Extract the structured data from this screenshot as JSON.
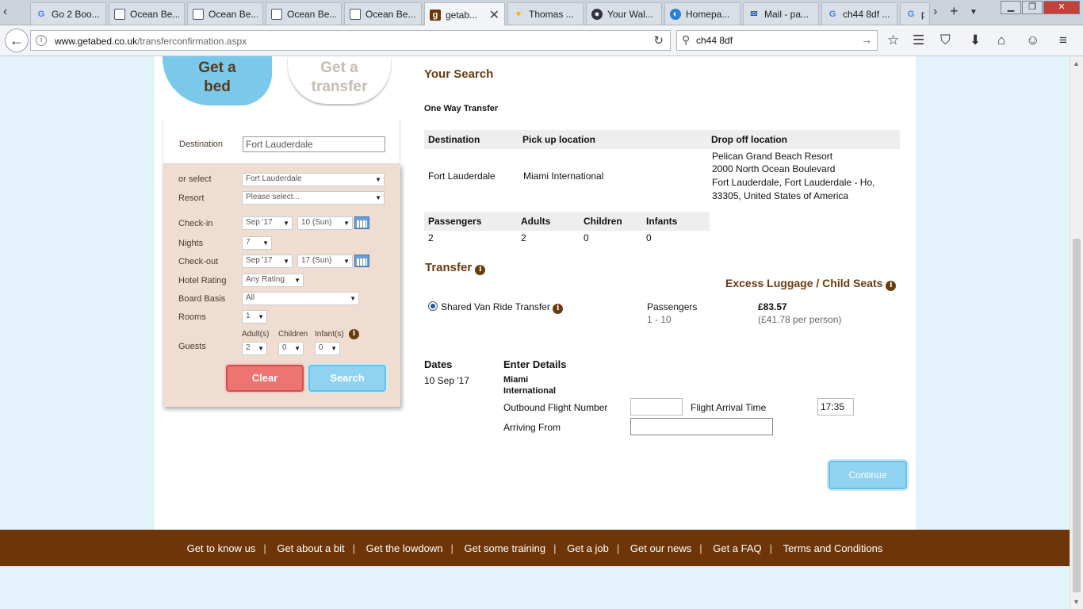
{
  "browser": {
    "tabs": [
      {
        "label": "Go 2 Boo...",
        "icon": "google-icon"
      },
      {
        "label": "Ocean Be...",
        "icon": "doc-icon"
      },
      {
        "label": "Ocean Be...",
        "icon": "doc-icon"
      },
      {
        "label": "Ocean Be...",
        "icon": "doc-icon"
      },
      {
        "label": "Ocean Be...",
        "icon": "doc-icon"
      },
      {
        "label": "getab...",
        "icon": "getabed-icon"
      },
      {
        "label": "Thomas ...",
        "icon": "heart-icon"
      },
      {
        "label": "Your Wal...",
        "icon": "shield-icon"
      },
      {
        "label": "Homepa...",
        "icon": "globe-icon"
      },
      {
        "label": "Mail - pa...",
        "icon": "mail-icon"
      },
      {
        "label": "ch44 8df ...",
        "icon": "google-icon"
      },
      {
        "label": "p",
        "icon": "google-icon"
      }
    ],
    "url_domain": "www.getabed.co.uk",
    "url_path": "/transferconfirmation.aspx",
    "search_value": "ch44 8df"
  },
  "left_panel": {
    "tab_getabed_line1": "Get a",
    "tab_getabed_line2": "bed",
    "tab_transfer_line1": "Get a",
    "tab_transfer_line2": "transfer",
    "destination_label": "Destination",
    "destination_value": "Fort Lauderdale",
    "or_select_label": "or select",
    "or_select_value": "Fort Lauderdale",
    "resort_label": "Resort",
    "resort_value": "Please select...",
    "checkin_label": "Check-in",
    "checkin_month": "Sep '17",
    "checkin_day": "10 (Sun)",
    "nights_label": "Nights",
    "nights_value": "7",
    "checkout_label": "Check-out",
    "checkout_month": "Sep '17",
    "checkout_day": "17 (Sun)",
    "hotel_rating_label": "Hotel Rating",
    "hotel_rating_value": "Any Rating",
    "board_basis_label": "Board Basis",
    "board_basis_value": "All",
    "rooms_label": "Rooms",
    "rooms_value": "1",
    "guests_label": "Guests",
    "adults_label": "Adult(s)",
    "children_label": "Children",
    "infants_label": "Infant(s)",
    "adults_value": "2",
    "children_value": "0",
    "infants_value": "0",
    "clear_label": "Clear",
    "search_label": "Search"
  },
  "search_summary": {
    "title": "Your Search",
    "type": "One Way Transfer",
    "col_destination": "Destination",
    "col_pickup": "Pick up location",
    "col_dropoff": "Drop off location",
    "destination": "Fort Lauderdale",
    "pickup": "Miami International",
    "dropoff_line1": "Pelican Grand Beach Resort",
    "dropoff_line2": "2000 North Ocean Boulevard",
    "dropoff_line3": "Fort Lauderdale, Fort Lauderdale - Ho,",
    "dropoff_line4": "33305, United States of America",
    "col_passengers": "Passengers",
    "col_adults": "Adults",
    "col_children": "Children",
    "col_infants": "Infants",
    "passengers": "2",
    "adults": "2",
    "children": "0",
    "infants": "0"
  },
  "transfer": {
    "title": "Transfer",
    "excess_title": "Excess Luggage / Child Seats",
    "option_label": "Shared Van Ride Transfer",
    "passengers_label": "Passengers",
    "passengers_range": "1 - 10",
    "price": "£83.57",
    "price_per_person": "(£41.78 per person)"
  },
  "details": {
    "dates_label": "Dates",
    "date_value": "10 Sep '17",
    "enter_details_label": "Enter Details",
    "airport_line1": "Miami",
    "airport_line2": "International",
    "outbound_label": "Outbound Flight Number",
    "outbound_value": "",
    "arrival_time_label": "Flight Arrival Time",
    "arrival_time_value": "17:35",
    "arriving_from_label": "Arriving From",
    "arriving_from_value": "",
    "continue_label": "Continue"
  },
  "footer": {
    "links": [
      "Get to know us",
      "Get about a bit",
      "Get the lowdown",
      "Get some training",
      "Get a job",
      "Get our news",
      "Get a FAQ",
      "Terms and Conditions"
    ]
  },
  "colors": {
    "brand_brown": "#6e3608",
    "accent_blue": "#7ac8ea",
    "clear_red": "#ed7470",
    "panel_beige": "#f0ddd1"
  }
}
